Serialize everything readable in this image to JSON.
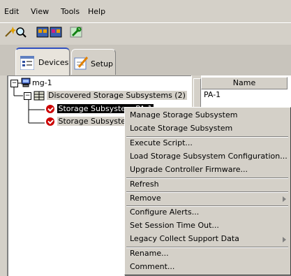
{
  "menubar": {
    "items": [
      {
        "label": "Edit"
      },
      {
        "label": "View"
      },
      {
        "label": "Tools"
      },
      {
        "label": "Help"
      }
    ]
  },
  "toolbar": {
    "buttons": [
      {
        "icon": "wand-icon"
      },
      {
        "icon": "magnify-icon"
      },
      {
        "icon": "storage-left-icon"
      },
      {
        "icon": "storage-right-icon"
      },
      {
        "icon": "wrench-icon"
      }
    ]
  },
  "tabs": [
    {
      "label": "Devices",
      "active": true
    },
    {
      "label": "Setup",
      "active": false
    }
  ],
  "tree": {
    "root": "mg-1",
    "group": "Discovered Storage Subsystems (2)",
    "children": [
      {
        "label": "Storage Subsystem PA-1",
        "selected": true
      },
      {
        "label": "Storage Subsystem",
        "selected": false
      }
    ]
  },
  "table": {
    "column_header": "Name",
    "rows": [
      "PA-1"
    ]
  },
  "context_menu": {
    "items": [
      {
        "label": "Manage Storage Subsystem"
      },
      {
        "label": "Locate Storage Subsystem"
      },
      {
        "label": "Execute Script..."
      },
      {
        "label": "Load Storage Subsystem Configuration..."
      },
      {
        "label": "Upgrade Controller Firmware..."
      },
      {
        "label": "Refresh"
      },
      {
        "label": "Remove",
        "submenu": true
      },
      {
        "label": "Configure Alerts..."
      },
      {
        "label": "Set Session Time Out..."
      },
      {
        "label": "Legacy Collect Support Data",
        "submenu": true
      },
      {
        "label": "Rename..."
      },
      {
        "label": "Comment..."
      }
    ]
  },
  "colors": {
    "window_bg": "#d4d0c8",
    "selection_bg": "#000000",
    "status_red": "#cc0000",
    "active_tab_accent": "#3050c0"
  }
}
